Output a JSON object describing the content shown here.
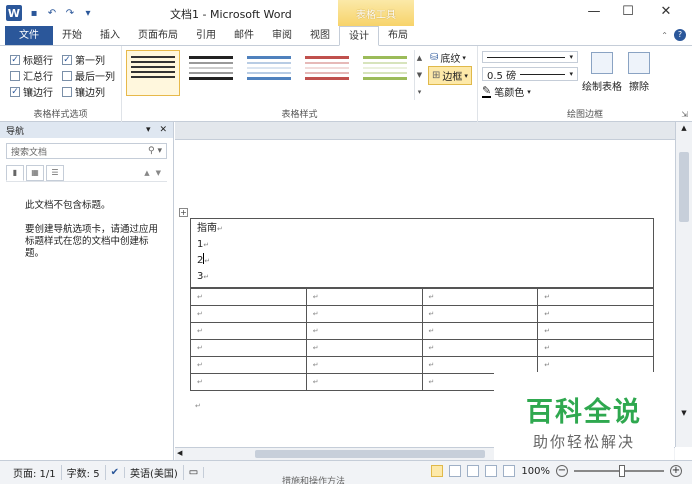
{
  "titlebar": {
    "logo": "W",
    "title": "文档1 - Microsoft Word",
    "context_tab_title": "表格工具",
    "minimize": "—",
    "maximize": "☐",
    "close": "✕"
  },
  "tabs": [
    {
      "label": "文件"
    },
    {
      "label": "开始"
    },
    {
      "label": "插入"
    },
    {
      "label": "页面布局"
    },
    {
      "label": "引用"
    },
    {
      "label": "邮件"
    },
    {
      "label": "审阅"
    },
    {
      "label": "视图"
    },
    {
      "label": "设计"
    },
    {
      "label": "布局"
    }
  ],
  "ribbon": {
    "style_options": {
      "header_row": "标题行",
      "first_column": "第一列",
      "total_row": "汇总行",
      "last_column": "最后一列",
      "banded_rows": "镶边行",
      "banded_columns": "镶边列",
      "label": "表格样式选项",
      "checked": {
        "header_row": true,
        "first_column": true,
        "total_row": false,
        "last_column": false,
        "banded_rows": true,
        "banded_columns": false
      }
    },
    "table_styles": {
      "label": "表格样式",
      "shading": "底纹",
      "borders": "边框"
    },
    "draw_borders": {
      "pen_weight": "0.5 磅",
      "pen_color": "笔颜色",
      "draw_table": "绘制表格",
      "eraser": "擦除",
      "label": "绘图边框"
    }
  },
  "nav": {
    "title": "导航",
    "search_placeholder": "搜索文档",
    "message1": "此文档不包含标题。",
    "message2": "要创建导航选项卡，请通过应用标题样式在您的文档中创建标题。"
  },
  "document": {
    "lines": [
      "指南",
      "1",
      "2",
      "3"
    ]
  },
  "status": {
    "page": "页面: 1/1",
    "words": "字数: 5",
    "language": "英语(美国)",
    "zoom": "100%"
  },
  "watermark": {
    "main": "百科全说",
    "sub": "助你轻松解决"
  },
  "clip_text": "措施和操作方法"
}
